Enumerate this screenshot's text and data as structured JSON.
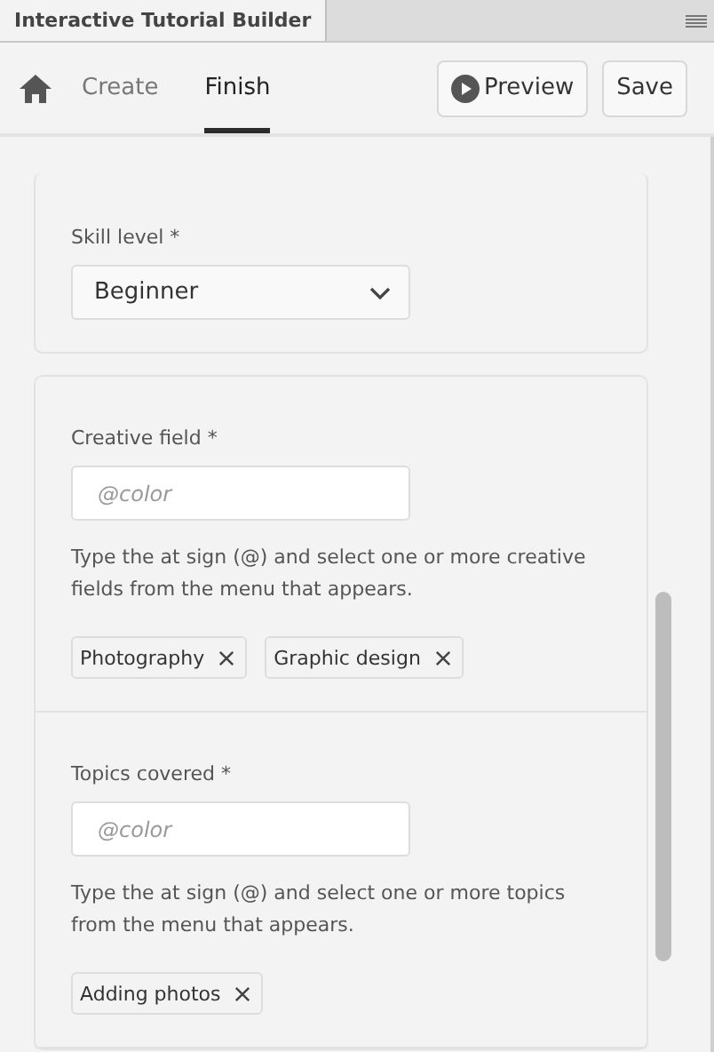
{
  "panel": {
    "title": "Interactive Tutorial Builder"
  },
  "nav": {
    "tabs": [
      {
        "label": "Create",
        "selected": false
      },
      {
        "label": "Finish",
        "selected": true
      }
    ],
    "buttons": [
      {
        "label": "Preview",
        "kind": "play"
      },
      {
        "label": "Save",
        "kind": "plain"
      }
    ]
  },
  "skill": {
    "label": "Skill level *",
    "value": "Beginner"
  },
  "sections": [
    {
      "label": "Creative field *",
      "placeholder": "@color",
      "help": "Type the at sign (@) and select one or more creative fields from the menu that appears.",
      "tags": [
        "Photography",
        "Graphic design"
      ]
    },
    {
      "label": "Topics covered *",
      "placeholder": "@color",
      "help": "Type the at sign (@) and select one or more topics from the menu that appears.",
      "tags": [
        "Adding photos"
      ]
    }
  ]
}
